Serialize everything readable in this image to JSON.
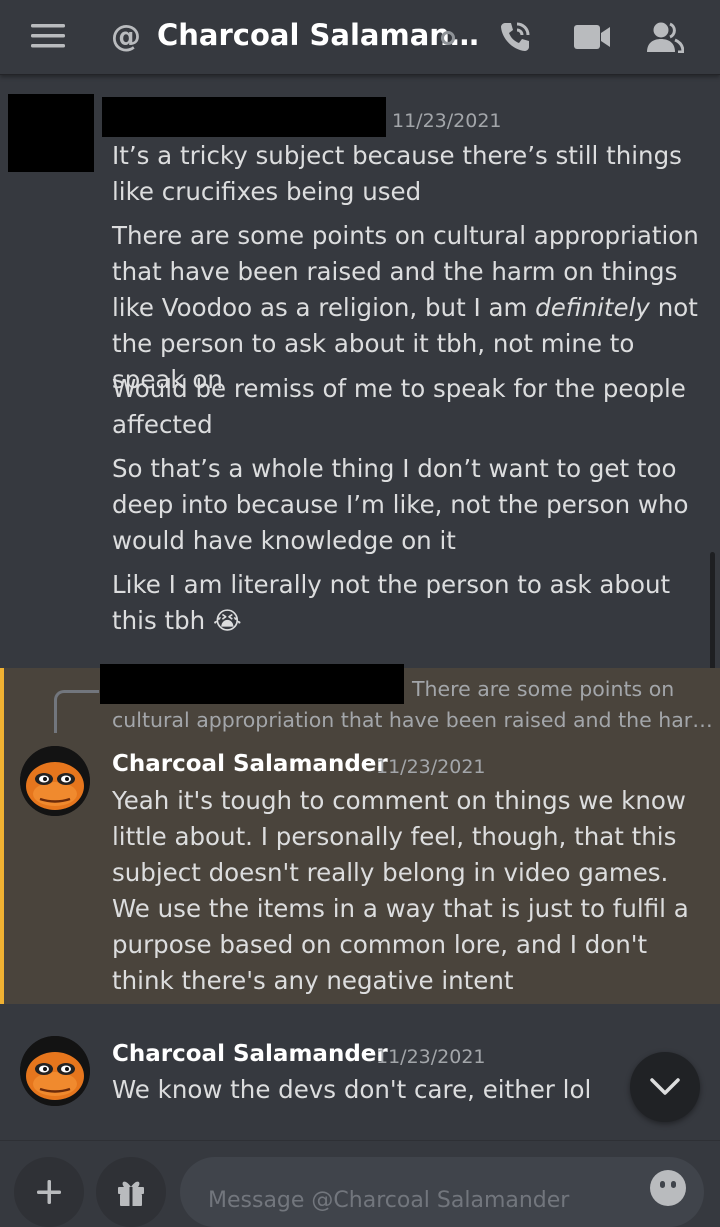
{
  "header": {
    "title": "Charcoal Salaman…",
    "at_symbol": "@",
    "icons": [
      "menu-icon",
      "at-icon",
      "status-dot-icon",
      "call-icon",
      "video-icon",
      "members-icon"
    ]
  },
  "messages": [
    {
      "timestamp": "11/23/2021",
      "lines": [
        "It’s a tricky subject because there’s still things like crucifixes being used",
        {
          "before": "There are some points on cultural appropriation that have been raised and the harm on things like Voodoo as a religion, but I am ",
          "emphasis": "definitely",
          "after": " not the person to ask about it tbh, not mine to speak on"
        },
        "Would be remiss of me to speak for the people affected",
        "So that’s a whole thing I don’t want to get too deep into because I’m like, not the person who would have knowledge on it",
        "Like I am literally not the person to ask about this tbh"
      ],
      "emoji": "😭"
    },
    {
      "reply_preview_1": "There are some points on",
      "reply_preview_2": "cultural appropriation that have been raised and the har…",
      "author": "Charcoal Salamander",
      "timestamp": "11/23/2021",
      "text": "Yeah it's tough to comment on things we know little about. I personally feel, though, that this subject doesn't really belong in video games. We use the items in a way that is just to fulfil a purpose based on common lore, and I don't think there's any negative intent",
      "highlighted": true
    },
    {
      "author": "Charcoal Salamander",
      "timestamp": "11/23/2021",
      "text": "We know the devs don't care, either lol"
    }
  ],
  "composer": {
    "placeholder": "Message @Charcoal Salamander",
    "icons": [
      "plus-icon",
      "gift-icon",
      "emoji-icon",
      "chevron-down-icon"
    ]
  },
  "colors": {
    "background": "#36393f",
    "highlight_bg": "#4a443c",
    "highlight_border": "#f0b132",
    "text": "#dcddde",
    "muted": "#a3a6aa",
    "avatar_orange": "#e6761d"
  }
}
